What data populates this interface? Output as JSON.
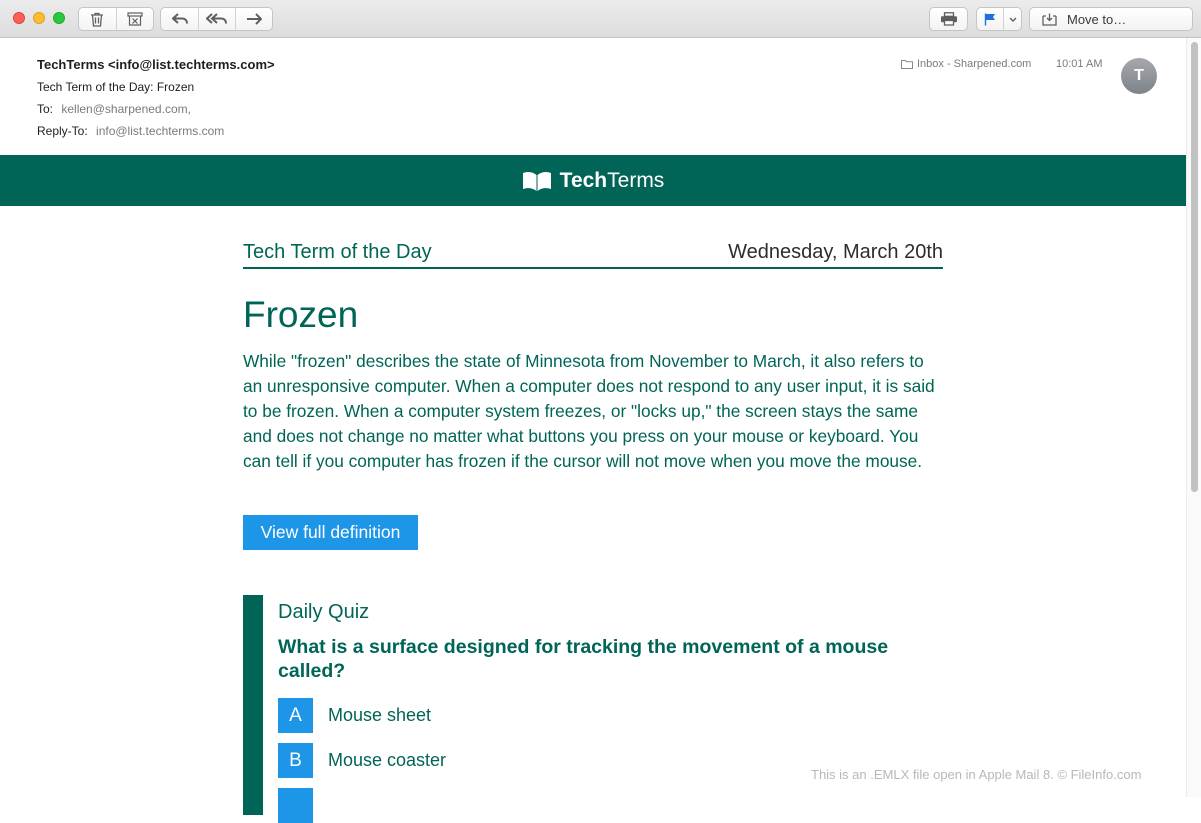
{
  "toolbar": {
    "buttons": {
      "delete": "trash-icon",
      "junk": "junk-icon",
      "reply": "reply-icon",
      "reply_all": "reply-all-icon",
      "forward": "forward-icon",
      "print": "printer-icon",
      "flag": "flag-icon",
      "flag_menu": "chevron-down-icon"
    },
    "move_to_label": "Move to…",
    "flag_color": "#1e6fe0"
  },
  "header": {
    "from": "TechTerms <info@list.techterms.com>",
    "subject": "Tech Term of the Day: Frozen",
    "to_label": "To:",
    "to_value": "kellen@sharpened.com,",
    "reply_to_label": "Reply-To:",
    "reply_to_value": "info@list.techterms.com",
    "mailbox": "Inbox - Sharpened.com",
    "time": "10:01 AM",
    "avatar_initial": "T"
  },
  "email": {
    "brand_bold": "Tech",
    "brand_rest": "Terms",
    "brand_color": "#006556",
    "section_label": "Tech Term of the Day",
    "date": "Wednesday, March 20th",
    "term": "Frozen",
    "definition": "While \"frozen\" describes the state of Minnesota from November to March, it also refers to an unresponsive computer. When a computer does not respond to any user input, it is said to be frozen. When a computer system freezes, or \"locks up,\" the screen stays the same and does not change no matter what buttons you press on your mouse or keyboard. You can tell if you computer has frozen if the cursor will not move when you move the mouse.",
    "button_label": "View full definition",
    "button_color": "#1e96e8",
    "quiz": {
      "title": "Daily Quiz",
      "question": "What is a surface designed for tracking the movement of a mouse called?",
      "answers": [
        {
          "letter": "A",
          "text": "Mouse sheet"
        },
        {
          "letter": "B",
          "text": "Mouse coaster"
        }
      ]
    }
  },
  "watermark": "This is an .EMLX file open in Apple Mail 8. © FileInfo.com"
}
